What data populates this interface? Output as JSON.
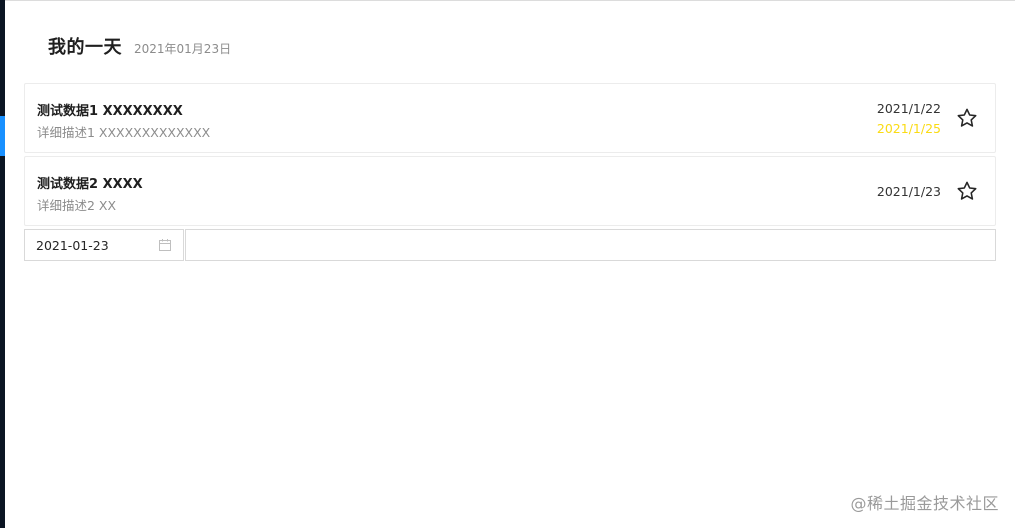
{
  "header": {
    "title": "我的一天",
    "date": "2021年01月23日"
  },
  "tasks": [
    {
      "title": "测试数据1 XXXXXXXX",
      "description": "详细描述1 XXXXXXXXXXXXX",
      "created_date": "2021/1/22",
      "due_date": "2021/1/25",
      "starred": false
    },
    {
      "title": "测试数据2 XXXX",
      "description": "详细描述2 XX",
      "created_date": "2021/1/23",
      "due_date": null,
      "starred": false
    }
  ],
  "add_task": {
    "date_value": "2021-01-23",
    "input_value": "",
    "date_icon": "calendar-icon"
  },
  "icons": {
    "star": "star-outline-icon"
  },
  "colors": {
    "accent": "#1890ff",
    "due_date": "#fadb14",
    "rail": "#0b1523"
  },
  "watermark": "@稀土掘金技术社区"
}
